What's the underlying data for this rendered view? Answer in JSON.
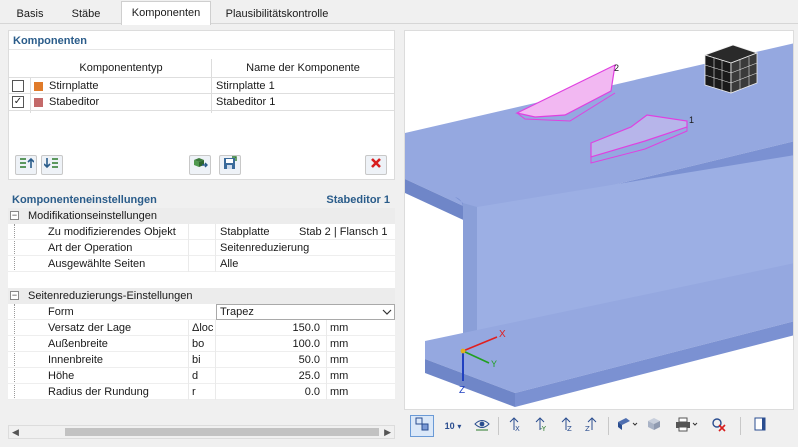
{
  "tabs": [
    "Basis",
    "Stäbe",
    "Komponenten",
    "Plausibilitätskontrolle"
  ],
  "active_tab": 2,
  "components": {
    "title": "Komponenten",
    "columns": [
      "Komponententyp",
      "Name der Komponente"
    ],
    "rows": [
      {
        "checked": false,
        "checkmark": "",
        "color": "#e07b2a",
        "type": "Stirnplatte",
        "name": "Stirnplatte 1"
      },
      {
        "checked": true,
        "checkmark": "✓",
        "color": "#c46a6a",
        "type": "Stabeditor",
        "name": "Stabeditor 1"
      }
    ],
    "toolbar_icons": [
      "move-up-icon",
      "move-down-icon",
      "import-icon",
      "save-icon",
      "delete-icon"
    ]
  },
  "settings": {
    "title": "Komponenteneinstellungen",
    "selected": "Stabeditor 1",
    "groups": [
      {
        "name": "Modifikationseinstellungen",
        "expander": "−",
        "rows": [
          {
            "label": "Zu modifizierendes Objekt",
            "symbol": "",
            "value": "Stabplatte",
            "unit": "Stab 2 | Flansch 1"
          },
          {
            "label": "Art der Operation",
            "symbol": "",
            "value": "Seitenreduzierung",
            "unit": ""
          },
          {
            "label": "Ausgewählte Seiten",
            "symbol": "",
            "value": "Alle",
            "unit": ""
          }
        ]
      },
      {
        "name": "Seitenreduzierungs-Einstellungen",
        "expander": "−",
        "rows": [
          {
            "label": "Form",
            "symbol": "",
            "value": "Trapez",
            "unit": "",
            "combo": true
          },
          {
            "label": "Versatz der Lage",
            "symbol": "Δloc",
            "value": "150.0",
            "unit": "mm"
          },
          {
            "label": "Außenbreite",
            "symbol": "bo",
            "value": "100.0",
            "unit": "mm"
          },
          {
            "label": "Innenbreite",
            "symbol": "bi",
            "value": "50.0",
            "unit": "mm"
          },
          {
            "label": "Höhe",
            "symbol": "d",
            "value": "25.0",
            "unit": "mm"
          },
          {
            "label": "Radius der Rundung",
            "symbol": "r",
            "value": "0.0",
            "unit": "mm"
          }
        ]
      }
    ]
  },
  "viewport": {
    "axes": {
      "x": "X",
      "y": "Y",
      "z": "Z"
    },
    "markers": [
      "1",
      "2"
    ],
    "colors": {
      "beam": "#8da2dc",
      "beam_dark": "#6f86c8",
      "highlight": "#e040e0"
    }
  },
  "view_toolbar": {
    "zoom_label": "10",
    "icons": [
      "select-view-icon",
      "scale-icon",
      "visibility-icon",
      "view-x-icon",
      "view-neg-y-icon",
      "view-z-icon",
      "view-iso-icon",
      "render-mode-icon",
      "box-view-icon",
      "print-icon",
      "reset-icon",
      "panel-icon"
    ]
  }
}
